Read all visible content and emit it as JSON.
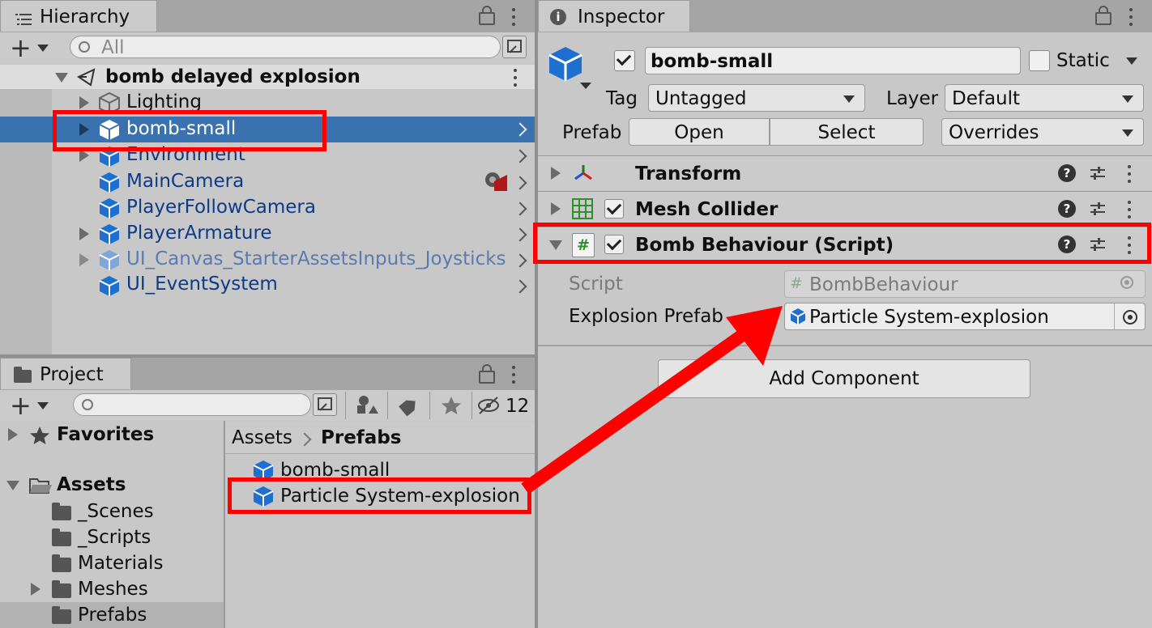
{
  "hierarchy": {
    "tab_label": "Hierarchy",
    "search_placeholder": "All",
    "scene_name": "bomb delayed explosion",
    "items": [
      {
        "label": "Lighting"
      },
      {
        "label": "bomb-small"
      },
      {
        "label": "Environment"
      },
      {
        "label": "MainCamera"
      },
      {
        "label": "PlayerFollowCamera"
      },
      {
        "label": "PlayerArmature"
      },
      {
        "label": "UI_Canvas_StarterAssetsInputs_Joysticks"
      },
      {
        "label": "UI_EventSystem"
      }
    ]
  },
  "project": {
    "tab_label": "Project",
    "hidden_count": "12",
    "tree": {
      "favorites": "Favorites",
      "assets": "Assets",
      "folders": [
        "_Scenes",
        "_Scripts",
        "Materials",
        "Meshes",
        "Prefabs"
      ]
    },
    "breadcrumb": {
      "root": "Assets",
      "current": "Prefabs"
    },
    "files": [
      "bomb-small",
      "Particle System-explosion"
    ]
  },
  "inspector": {
    "tab_label": "Inspector",
    "object_name": "bomb-small",
    "static_label": "Static",
    "tag_label": "Tag",
    "tag_value": "Untagged",
    "layer_label": "Layer",
    "layer_value": "Default",
    "prefab_label": "Prefab",
    "open_label": "Open",
    "select_label": "Select",
    "overrides_label": "Overrides",
    "components": [
      {
        "name": "Transform"
      },
      {
        "name": "Mesh Collider"
      },
      {
        "name": "Bomb Behaviour (Script)"
      }
    ],
    "script_label": "Script",
    "script_value": "BombBehaviour",
    "explosion_label": "Explosion Prefab",
    "explosion_value": "Particle System-explosion",
    "add_component": "Add Component"
  },
  "colors": {
    "selection": "#3a72b0",
    "highlight": "#ff0000",
    "cube_blue": "#1f6fd0"
  }
}
